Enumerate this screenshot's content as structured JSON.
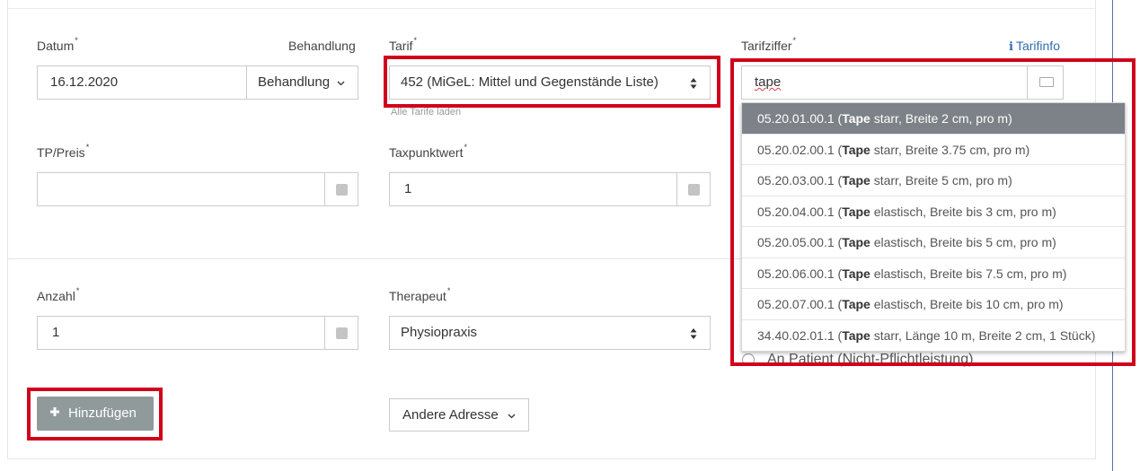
{
  "form": {
    "datum": {
      "label": "Datum",
      "required": "*",
      "value": "16.12.2020"
    },
    "behandlung": {
      "label": "Behandlung",
      "button": "Behandlung"
    },
    "tarif": {
      "label": "Tarif",
      "required": "*",
      "value": "452 (MiGeL: Mittel und Gegenstände Liste)",
      "hint": "Alle Tarife laden"
    },
    "tarifziffer": {
      "label": "Tarifziffer",
      "required": "*",
      "value": "tape",
      "info": "Tarifinfo"
    },
    "tp_preis": {
      "label": "TP/Preis",
      "required": "*",
      "value": ""
    },
    "taxpunktwert": {
      "label": "Taxpunktwert",
      "required": "*",
      "value": "1"
    },
    "anzahl": {
      "label": "Anzahl",
      "required": "*",
      "value": "1"
    },
    "therapeut": {
      "label": "Therapeut",
      "required": "*",
      "value": "Physiopraxis"
    },
    "radio_option": "An Patient (Nicht-Pflichtleistung)"
  },
  "dropdown": {
    "items": [
      {
        "code": "05.20.01.00.1 (",
        "bold": "Tape",
        "rest": " starr, Breite 2 cm, pro m)"
      },
      {
        "code": "05.20.02.00.1 (",
        "bold": "Tape",
        "rest": " starr, Breite 3.75 cm, pro m)"
      },
      {
        "code": "05.20.03.00.1 (",
        "bold": "Tape",
        "rest": " starr, Breite 5 cm, pro m)"
      },
      {
        "code": "05.20.04.00.1 (",
        "bold": "Tape",
        "rest": " elastisch, Breite bis 3 cm, pro m)"
      },
      {
        "code": "05.20.05.00.1 (",
        "bold": "Tape",
        "rest": " elastisch, Breite bis 5 cm, pro m)"
      },
      {
        "code": "05.20.06.00.1 (",
        "bold": "Tape",
        "rest": " elastisch, Breite bis 7.5 cm, pro m)"
      },
      {
        "code": "05.20.07.00.1 (",
        "bold": "Tape",
        "rest": " elastisch, Breite bis 10 cm, pro m)"
      },
      {
        "code": "34.40.02.01.1 (",
        "bold": "Tape",
        "rest": " starr, Länge 10 m, Breite 2 cm, 1 Stück)"
      }
    ]
  },
  "buttons": {
    "add": "Hinzufügen",
    "other_address": "Andere Adresse"
  },
  "icons": {
    "plus": "+",
    "chevron": "chevron-down-icon",
    "updown": "sort-icon",
    "keyboard": "keyboard-icon",
    "info": "info-icon"
  },
  "colors": {
    "highlight": "#d0021b",
    "active_item": "#7c8287",
    "add_button": "#909a9b",
    "link": "#2f6db0"
  }
}
